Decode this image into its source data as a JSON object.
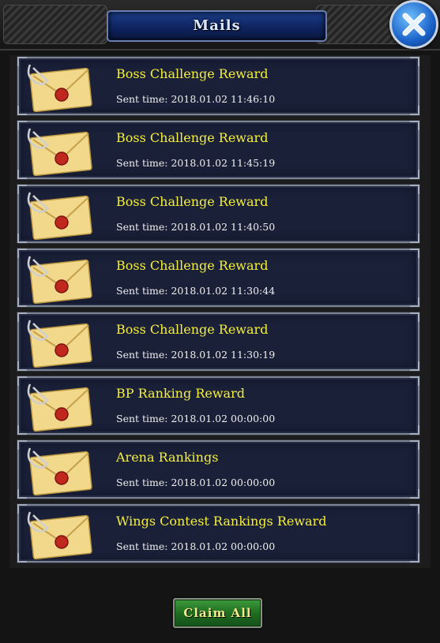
{
  "header": {
    "title": "Mails",
    "close_icon": "close-x-icon"
  },
  "mails": [
    {
      "title": "Boss Challenge Reward",
      "time": "Sent time: 2018.01.02 11:46:10",
      "icon": "envelope-with-paperclip-icon"
    },
    {
      "title": "Boss Challenge Reward",
      "time": "Sent time: 2018.01.02 11:45:19",
      "icon": "envelope-with-paperclip-icon"
    },
    {
      "title": "Boss Challenge Reward",
      "time": "Sent time: 2018.01.02 11:40:50",
      "icon": "envelope-with-paperclip-icon"
    },
    {
      "title": "Boss Challenge Reward",
      "time": "Sent time: 2018.01.02 11:30:44",
      "icon": "envelope-with-paperclip-icon"
    },
    {
      "title": "Boss Challenge Reward",
      "time": "Sent time: 2018.01.02 11:30:19",
      "icon": "envelope-with-paperclip-icon"
    },
    {
      "title": "BP Ranking Reward",
      "time": "Sent time: 2018.01.02 00:00:00",
      "icon": "envelope-with-paperclip-icon"
    },
    {
      "title": "Arena Rankings",
      "time": "Sent time: 2018.01.02 00:00:00",
      "icon": "envelope-with-paperclip-icon"
    },
    {
      "title": "Wings Contest Rankings Reward",
      "time": "Sent time: 2018.01.02 00:00:00",
      "icon": "envelope-with-paperclip-icon"
    }
  ],
  "footer": {
    "claim_all_label": "Claim All"
  },
  "colors": {
    "title_text": "#f4ef3c",
    "time_text": "#f0f0f0",
    "item_background": "#1a2038",
    "header_bar": "#0f2460",
    "claim_button": "#1e6a1e"
  }
}
